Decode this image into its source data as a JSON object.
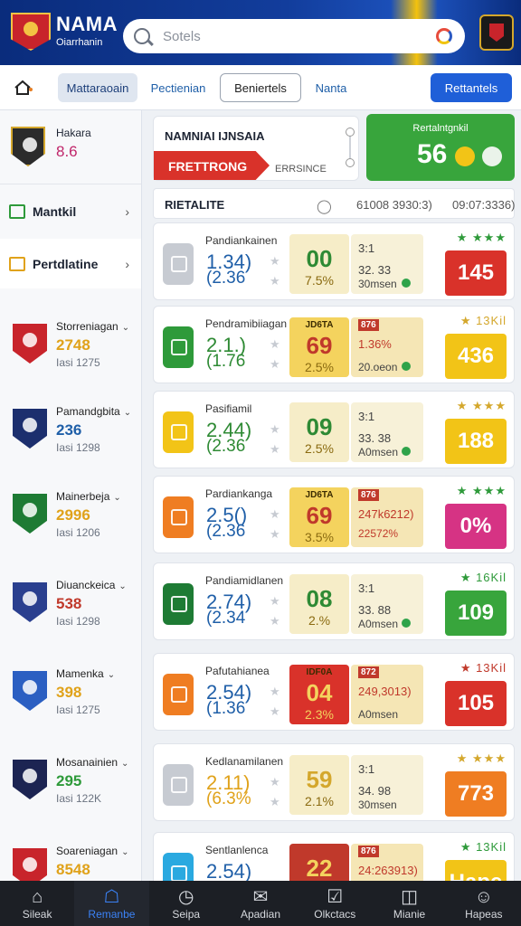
{
  "header": {
    "brand_title": "NAMA",
    "brand_sub": "Oiarrhanin",
    "search_placeholder": "Sotels"
  },
  "tabs": {
    "items": [
      {
        "label": "Mattaraoain"
      },
      {
        "label": "Pectienian"
      },
      {
        "label": "Beniertels"
      },
      {
        "label": "Nanta"
      },
      {
        "label": "Rettantels"
      }
    ]
  },
  "sidebar": {
    "top": {
      "name": "Hakara",
      "value": "8.6"
    },
    "nav": [
      {
        "label": "Mantkil"
      },
      {
        "label": "Pertdlatine"
      }
    ],
    "teams": [
      {
        "name": "Storreniagan",
        "value": "2748",
        "sub": "Iasi 1275",
        "color": "#e0a21a"
      },
      {
        "name": "Pamandgbita",
        "value": "236",
        "sub": "Iasi 1298",
        "color": "#1f5fa8"
      },
      {
        "name": "Mainerbeja",
        "value": "2996",
        "sub": "Iasi 1206",
        "color": "#e0a21a"
      },
      {
        "name": "Diuanckeica",
        "value": "538",
        "sub": "Iasi 1298",
        "color": "#c0392b"
      },
      {
        "name": "Mamenka",
        "value": "398",
        "sub": "Iasi 1275",
        "color": "#e0a21a"
      },
      {
        "name": "Mosanainien",
        "value": "295",
        "sub": "Iasi 122K",
        "color": "#2e9a3a"
      },
      {
        "name": "Soareniagan",
        "value": "8548",
        "sub": "",
        "color": "#e0a21a"
      }
    ]
  },
  "summary": {
    "title": "NAMNIAI IJNSAIA",
    "banner": "FRETTRONG",
    "sub": "ERRSINCE",
    "score_title": "Rertalntgnkil",
    "score_value": "56"
  },
  "table": {
    "col1": "RIETALITE",
    "col2": "61008 3930:3)",
    "col3": "09:07:3336)"
  },
  "rows": [
    {
      "name": "Pandiankainen",
      "v1": "1.34)",
      "v2": "(2.36",
      "center": "00",
      "center_sub": "7.5%",
      "center_label": "",
      "s1": "3:1",
      "s2": "32. 33",
      "s3": "30msen",
      "stars": "★ ★★★",
      "score": "145",
      "panel_label": ""
    },
    {
      "name": "Pendramibiiagan",
      "v1": "2.1.)",
      "v2": "(1.76",
      "center": "69",
      "center_sub": "2.5%",
      "center_label": "JD6TA",
      "s1": "1.36%",
      "s2": "",
      "s3": "20.oeon",
      "stars": "★ 13Kil",
      "score": "436",
      "panel_label": "876"
    },
    {
      "name": "Pasifiamil",
      "v1": "2.44)",
      "v2": "(2.36",
      "center": "09",
      "center_sub": "2.5%",
      "center_label": "",
      "s1": "3:1",
      "s2": "33. 38",
      "s3": "A0msen",
      "stars": "★ ★★★",
      "score": "188",
      "panel_label": ""
    },
    {
      "name": "Pardiankanga",
      "v1": "2.5()",
      "v2": "(2.36",
      "center": "69",
      "center_sub": "3.5%",
      "center_label": "JD6TA",
      "s1": "247k6212)",
      "s2": "",
      "s3": "22572%",
      "stars": "★ ★★★",
      "score": "0%",
      "panel_label": "876"
    },
    {
      "name": "Pandiamidlanen",
      "v1": "2.74)",
      "v2": "(2.34",
      "center": "08",
      "center_sub": "2.%",
      "center_label": "",
      "s1": "3:1",
      "s2": "33. 88",
      "s3": "A0msen",
      "stars": "★ 16Kil",
      "score": "109",
      "panel_label": ""
    },
    {
      "name": "Pafutahianea",
      "v1": "2.54)",
      "v2": "(1.36",
      "center": "04",
      "center_sub": "2.3%",
      "center_label": "IDF0A",
      "s1": "249,3013)",
      "s2": "",
      "s3": "A0msen",
      "stars": "★ 13Kil",
      "score": "105",
      "panel_label": "872"
    },
    {
      "name": "Kedlanamilanen",
      "v1": "2.11)",
      "v2": "(6.3%",
      "center": "59",
      "center_sub": "2.1%",
      "center_label": "",
      "s1": "3:1",
      "s2": "34. 98",
      "s3": "30msen",
      "stars": "★ ★★★",
      "score": "773",
      "panel_label": ""
    },
    {
      "name": "Sentlanlenca",
      "v1": "2.54)",
      "v2": "",
      "center": "22",
      "center_sub": "",
      "center_label": "",
      "s1": "24:263913)",
      "s2": "",
      "s3": "",
      "stars": "★ 13Kil",
      "score": "Hape",
      "panel_label": "876"
    }
  ],
  "bottom_nav": [
    {
      "label": "Sileak"
    },
    {
      "label": "Remanbe"
    },
    {
      "label": "Seipa"
    },
    {
      "label": "Apadian"
    },
    {
      "label": "Olkctacs"
    },
    {
      "label": "Mianie"
    },
    {
      "label": "Hapeas"
    }
  ]
}
